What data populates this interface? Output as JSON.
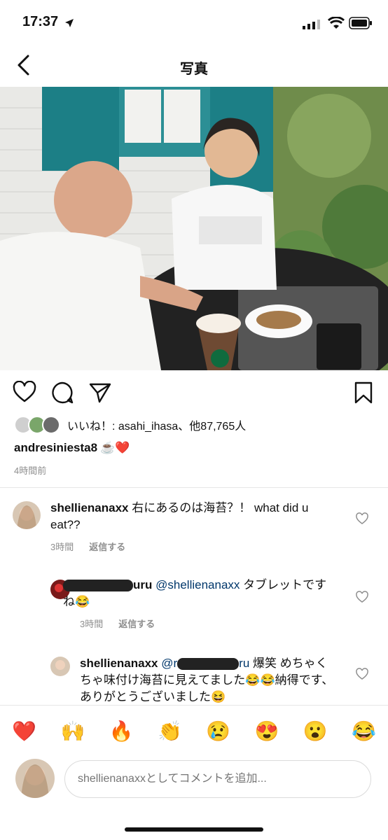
{
  "status": {
    "time": "17:37"
  },
  "header": {
    "title": "写真"
  },
  "post": {
    "likes_text": "いいね！: asahi_ihasa、他87,765人",
    "username": "andresiniesta8",
    "caption_emoji": "☕️❤️",
    "time_ago": "4時間前"
  },
  "comments": [
    {
      "username": "shellienanaxx",
      "text": " 右にあるのは海苔？！ what did u eat??",
      "time": "3時間",
      "reply_label": "返信する"
    },
    {
      "username_suffix": "uru",
      "mention": "@shellienanaxx",
      "text": " タブレットですね😂",
      "time": "3時間",
      "reply_label": "返信する"
    },
    {
      "username": "shellienanaxx",
      "mention_prefix": "@r",
      "mention_suffix": "ru",
      "text": " 爆笑 めちゃくちゃ味付け海苔に見えてました😂😂納得です、ありがとうございました😆"
    }
  ],
  "emoji_bar": [
    "❤️",
    "🙌",
    "🔥",
    "👏",
    "😢",
    "😍",
    "😮",
    "😂"
  ],
  "composer": {
    "placeholder": "shellienanaxxとしてコメントを追加..."
  }
}
